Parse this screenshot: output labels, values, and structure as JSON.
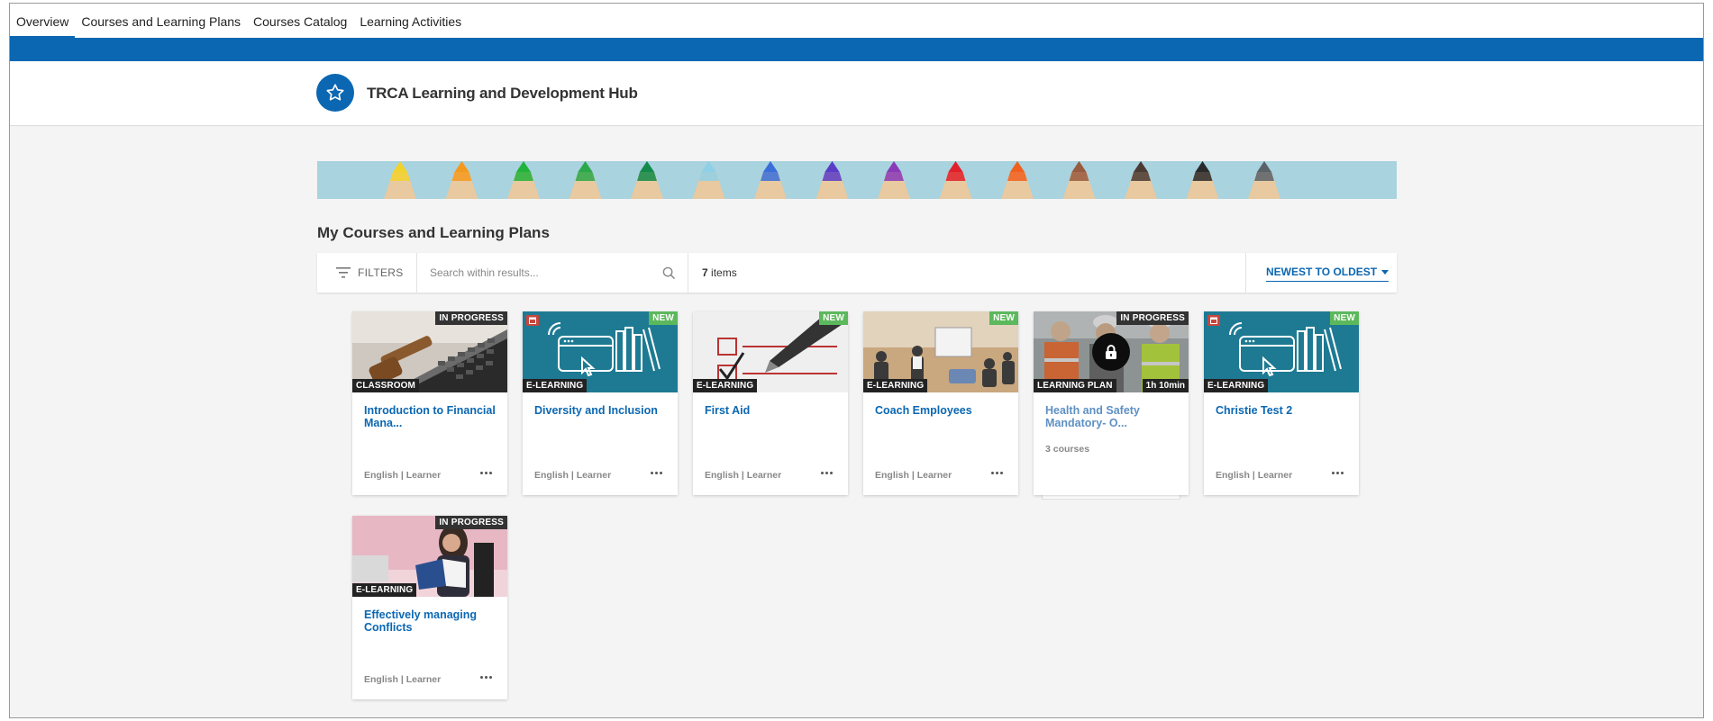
{
  "nav": {
    "tabs": [
      {
        "label": "Overview"
      },
      {
        "label": "Courses and Learning Plans"
      },
      {
        "label": "Courses Catalog"
      },
      {
        "label": "Learning Activities"
      }
    ]
  },
  "hub": {
    "title": "TRCA Learning and Development Hub",
    "logo_icon": "star-icon"
  },
  "section": {
    "title": "My Courses and Learning Plans"
  },
  "filterbar": {
    "filters_label": "FILTERS",
    "search_placeholder": "Search within results...",
    "items_count": "7",
    "items_label": " items",
    "sort_label": "NEWEST TO OLDEST"
  },
  "colors": {
    "accent": "#0b67b2",
    "new_badge": "#5cb85c",
    "type_badge": "#222222"
  },
  "cards": [
    {
      "status": "IN PROGRESS",
      "type": "CLASSROOM",
      "title": "Introduction to Financial Mana...",
      "meta": "English | Learner",
      "image": "gavel-laptop"
    },
    {
      "status": "NEW",
      "type": "E-LEARNING",
      "title": "Diversity and Inclusion",
      "meta": "English | Learner",
      "image": "elearning-graphic"
    },
    {
      "status": "NEW",
      "type": "E-LEARNING",
      "title": "First Aid",
      "meta": "English | Learner",
      "image": "checkbox-pen"
    },
    {
      "status": "NEW",
      "type": "E-LEARNING",
      "title": "Coach Employees",
      "meta": "English | Learner",
      "image": "meeting-room"
    },
    {
      "status": "IN PROGRESS",
      "type": "LEARNING PLAN",
      "duration": "1h 10min",
      "title": "Health and Safety Mandatory- O...",
      "sub": "3 courses",
      "image": "safety-workers"
    },
    {
      "status": "NEW",
      "type": "E-LEARNING",
      "title": "Christie Test 2",
      "meta": "English | Learner",
      "image": "elearning-graphic"
    },
    {
      "status": "IN PROGRESS",
      "type": "E-LEARNING",
      "title": "Effectively managing Conflicts",
      "meta": "English | Learner",
      "image": "woman-reading"
    }
  ]
}
